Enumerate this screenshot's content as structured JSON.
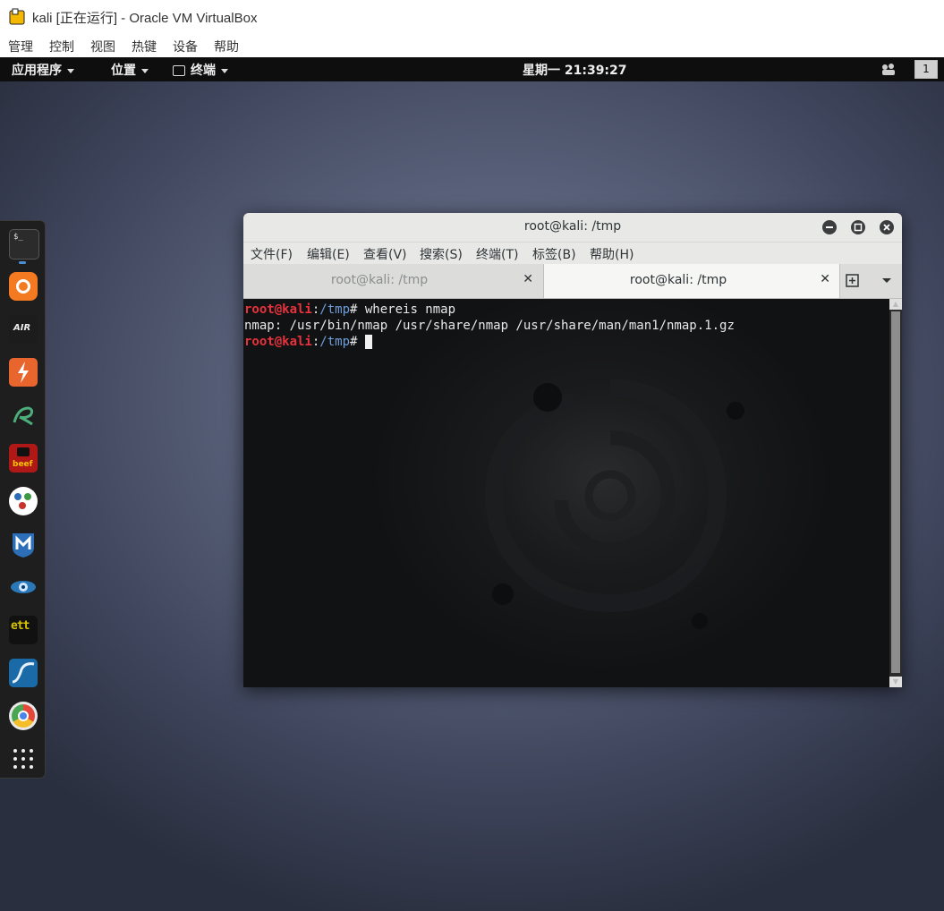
{
  "vbox": {
    "title": "kali [正在运行] - Oracle VM VirtualBox",
    "menu": [
      "管理",
      "控制",
      "视图",
      "热键",
      "设备",
      "帮助"
    ]
  },
  "topbar": {
    "applications": "应用程序",
    "places": "位置",
    "terminal": "终端",
    "clock": "星期一 21:39:27",
    "workspace": "1"
  },
  "dash": {
    "items": [
      {
        "icon": "terminal-icon",
        "color": "#2b2b2b"
      },
      {
        "icon": "firefox-icon",
        "color": "#f47a22"
      },
      {
        "icon": "aircrack-icon",
        "color": "#1c1c1c"
      },
      {
        "icon": "burpsuite-icon",
        "color": "#e8662d"
      },
      {
        "icon": "armitage-icon",
        "color": "#2a7a5a"
      },
      {
        "icon": "beef-icon",
        "color": "#b01818"
      },
      {
        "icon": "maltego-icon",
        "color": "#ffffff"
      },
      {
        "icon": "metasploit-icon",
        "color": "#2c6fb8"
      },
      {
        "icon": "zenmap-icon",
        "color": "#2a78b8"
      },
      {
        "icon": "ettercap-icon",
        "color": "#111111"
      },
      {
        "icon": "wireshark-icon",
        "color": "#1a6aa8"
      },
      {
        "icon": "chromium-icon",
        "color": "#e8e8e8"
      },
      {
        "icon": "show-apps-icon",
        "color": "#1e1e1e"
      }
    ]
  },
  "terminal": {
    "title": "root@kali: /tmp",
    "menu": [
      "文件(F)",
      "编辑(E)",
      "查看(V)",
      "搜索(S)",
      "终端(T)",
      "标签(B)",
      "帮助(H)"
    ],
    "tabs": [
      {
        "label": "root@kali: /tmp",
        "active": false
      },
      {
        "label": "root@kali: /tmp",
        "active": true
      }
    ],
    "lines": [
      {
        "user": "root@kali",
        "sep": ":",
        "path": "/tmp",
        "hash": "# ",
        "cmd": "whereis nmap"
      },
      {
        "output": "nmap: /usr/bin/nmap /usr/share/nmap /usr/share/man/man1/nmap.1.gz"
      },
      {
        "user": "root@kali",
        "sep": ":",
        "path": "/tmp",
        "hash": "# ",
        "cmd": ""
      }
    ]
  }
}
